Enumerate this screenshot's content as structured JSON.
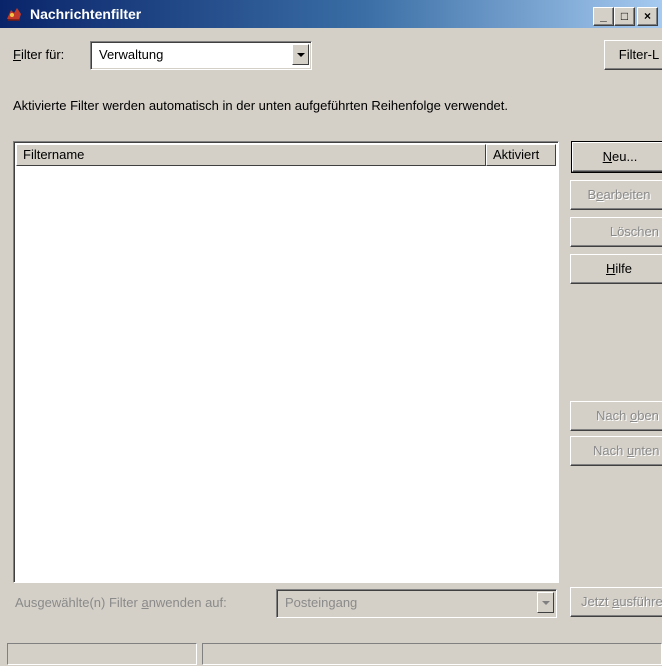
{
  "window": {
    "title": "Nachrichtenfilter"
  },
  "title_buttons": {
    "minimize": "_",
    "maximize": "□",
    "close": "×"
  },
  "filter_for": {
    "label_first": "F",
    "label_rest": "ilter für:",
    "value": "Verwaltung",
    "log_button": "Filter-L"
  },
  "description": "Aktivierte Filter werden automatisch in der unten aufgeführten Reihenfolge verwendet.",
  "filter_list": {
    "columns": [
      "Filtername",
      "Aktiviert"
    ],
    "rows": []
  },
  "buttons": {
    "new_first": "N",
    "new_rest": "eu...",
    "edit_pre": "B",
    "edit_u": "e",
    "edit_post": "arbeiten",
    "delete": "Löschen",
    "help_first": "H",
    "help_rest": "ilfe",
    "up_pre": "Nach ",
    "up_u": "o",
    "up_post": "ben",
    "down_pre": "Nach ",
    "down_u": "u",
    "down_post": "nten"
  },
  "apply": {
    "label_pre": "Ausgewählte(n) Filter ",
    "label_u": "a",
    "label_post": "nwenden auf:",
    "folder": "Posteingang",
    "run_pre": "Jetzt ",
    "run_u": "a",
    "run_post": "usführen"
  },
  "colors": {
    "titlebar_start": "#0a246a",
    "titlebar_end": "#a6caf0",
    "face": "#d4d0c8"
  }
}
